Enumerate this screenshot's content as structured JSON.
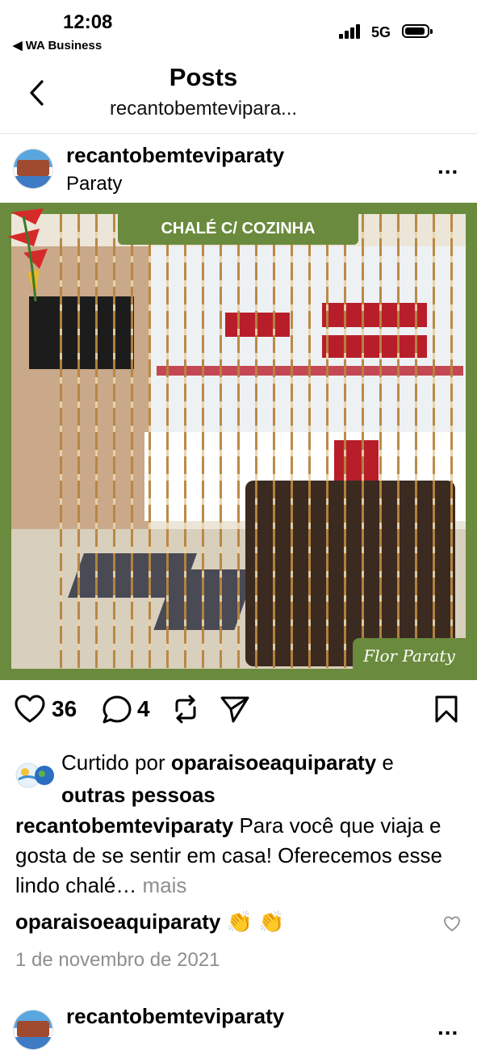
{
  "status_bar": {
    "time": "12:08",
    "back_app": "◀ WA Business",
    "network": "5G"
  },
  "nav": {
    "title": "Posts",
    "subtitle": "recantobemtevipara..."
  },
  "post": {
    "username": "recantobemteviparaty",
    "location": "Paraty",
    "more": "...",
    "image": {
      "badge_text": "CHALÉ C/ COZINHA",
      "brand_text": "Flor Paraty"
    },
    "likes_count": "36",
    "comments_count": "4",
    "liked_by_prefix": "Curtido por ",
    "liked_by_user": "oparaisoeaquiparaty",
    "liked_by_and": " e",
    "liked_by_others": "outras pessoas",
    "caption_user": "recantobemteviparaty",
    "caption_text": " Para você que viaja e gosta de se sentir em casa! Oferecemos esse lindo chalé…",
    "caption_more": " mais",
    "comment_user": "oparaisoeaquiparaty",
    "comment_text": " 👏 👏",
    "date": "1 de novembro de 2021"
  },
  "next_post": {
    "username": "recantobemteviparaty",
    "more": "..."
  },
  "colors": {
    "frame_green": "#6a8a3d",
    "gray_text": "#8e8e8e"
  }
}
